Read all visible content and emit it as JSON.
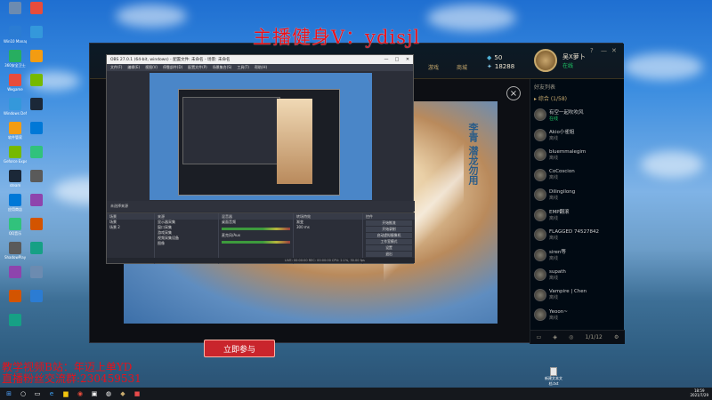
{
  "overlay": {
    "watermark": "主播健身V：ydisjl",
    "promo_line1": "教学视频B站：年迈上单YD",
    "promo_line2": "直播粉丝交流群:230459531"
  },
  "desktop": {
    "icons_left": [
      "",
      "Win10 Manager",
      "360安全卫士",
      "Wegame",
      "Windows Defender",
      "软件管家",
      "Geforce Experience",
      "steam",
      "应用商店",
      "QQ音乐",
      "ShadowPlay",
      "",
      "",
      ""
    ],
    "icons_right": [
      "",
      "",
      "",
      "",
      "",
      "",
      "",
      "",
      "",
      "",
      "",
      "",
      ""
    ],
    "recycle_bin": "新建文本文档.txt"
  },
  "lol_client": {
    "nav": [
      "游戏",
      "商城"
    ],
    "currency_rp": "50",
    "currency_be": "18288",
    "user_name": "吴X萝卜",
    "user_status": "在线",
    "join_button": "立即参与",
    "close": "×",
    "hero_title": "李青 潜龙勿用",
    "window_controls": [
      "?",
      "—",
      "✕"
    ],
    "friends_header": "好友列表",
    "group_label": "▸ 综合 (1/58)",
    "friends": [
      {
        "name": "有空一起吹吹风",
        "status": "在线",
        "online": true
      },
      {
        "name": "Akio小雀姐",
        "status": "离线",
        "online": false
      },
      {
        "name": "bluemmalegim",
        "status": "离线",
        "online": false
      },
      {
        "name": "CoCoscion",
        "status": "离线",
        "online": false
      },
      {
        "name": "Dilingilong",
        "status": "离线",
        "online": false
      },
      {
        "name": "EMP翻滚",
        "status": "离线",
        "online": false
      },
      {
        "name": "FLAGGED 74527842",
        "status": "离线",
        "online": false
      },
      {
        "name": "siren等",
        "status": "离线",
        "online": false
      },
      {
        "name": "supath",
        "status": "离线",
        "online": false
      },
      {
        "name": "Vampire | Chen",
        "status": "离线",
        "online": false
      },
      {
        "name": "Yeoon~",
        "status": "离线",
        "online": false
      }
    ],
    "friends_footer_count": "1/1/12"
  },
  "obs": {
    "title": "OBS 27.0.1 (64-bit, windows) - 配置文件: 未命名 - 场景: 未命名",
    "menu": [
      "文件(F)",
      "编辑(E)",
      "视图(V)",
      "停靠部件(D)",
      "配置文件(P)",
      "场景集合(S)",
      "工具(T)",
      "帮助(H)"
    ],
    "sub_label": "未选择来源",
    "scenes_head": "场景",
    "scenes": [
      "场景",
      "场景 2"
    ],
    "sources_head": "来源",
    "sources": [
      "显示器采集",
      "窗口采集",
      "游戏采集",
      "视频采集设备",
      "图像"
    ],
    "mixer_head": "混音器",
    "mixer_items": [
      "桌面音频",
      "麦克风/Aux"
    ],
    "transitions_head": "转场特效",
    "transition_value": "渐变",
    "duration": "300 ms",
    "controls_head": "控件",
    "controls": [
      "开始推流",
      "开始录制",
      "启动虚拟摄像机",
      "工作室模式",
      "设置",
      "退出"
    ],
    "status": "LIVE: 00:00:00   REC: 00:00:00   CPU: 2.1%, 30.00 fps"
  },
  "taskbar": {
    "start": "⊞",
    "clock_time": "18:59",
    "clock_date": "2021/7/29"
  }
}
